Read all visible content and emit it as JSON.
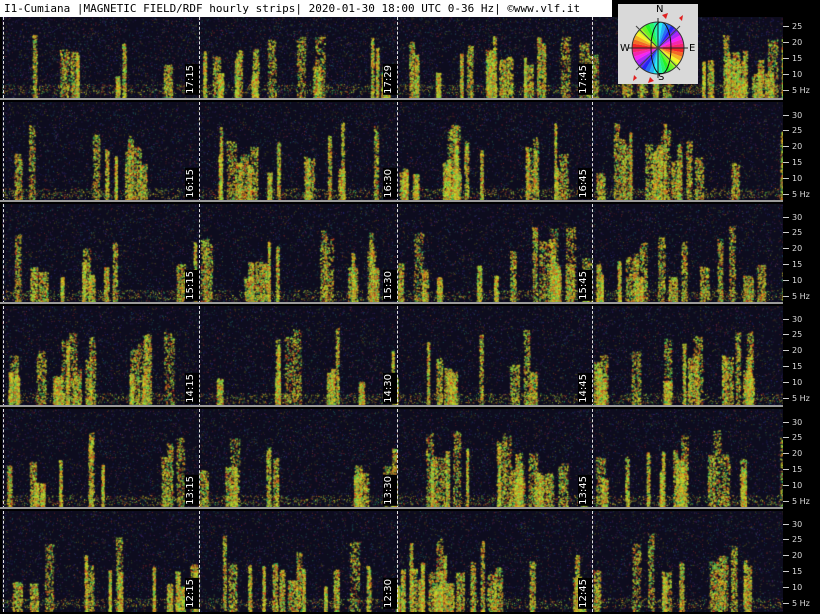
{
  "header": {
    "title": "I1-Cumiana |MAGNETIC FIELD/RDF hourly strips| 2020-01-30 18:00 UTC 0-36 Hz| ©www.vlf.it"
  },
  "compass": {
    "north": "N",
    "south": "S",
    "east": "E",
    "west": "W"
  },
  "frequency_scale": {
    "ticks": [
      "30",
      "25",
      "20",
      "15",
      "10",
      "5 Hz"
    ]
  },
  "strips": [
    {
      "hour": "17",
      "labels": [
        "17:15",
        "17:29",
        "17:45"
      ]
    },
    {
      "hour": "16",
      "labels": [
        "16:15",
        "16:30",
        "16:45"
      ]
    },
    {
      "hour": "15",
      "labels": [
        "15:15",
        "15:30",
        "15:45"
      ]
    },
    {
      "hour": "14",
      "labels": [
        "14:15",
        "14:30",
        "14:45"
      ]
    },
    {
      "hour": "13",
      "labels": [
        "13:15",
        "13:30",
        "13:45"
      ]
    },
    {
      "hour": "12",
      "labels": [
        "12:15",
        "12:30",
        "12:45"
      ]
    }
  ]
}
